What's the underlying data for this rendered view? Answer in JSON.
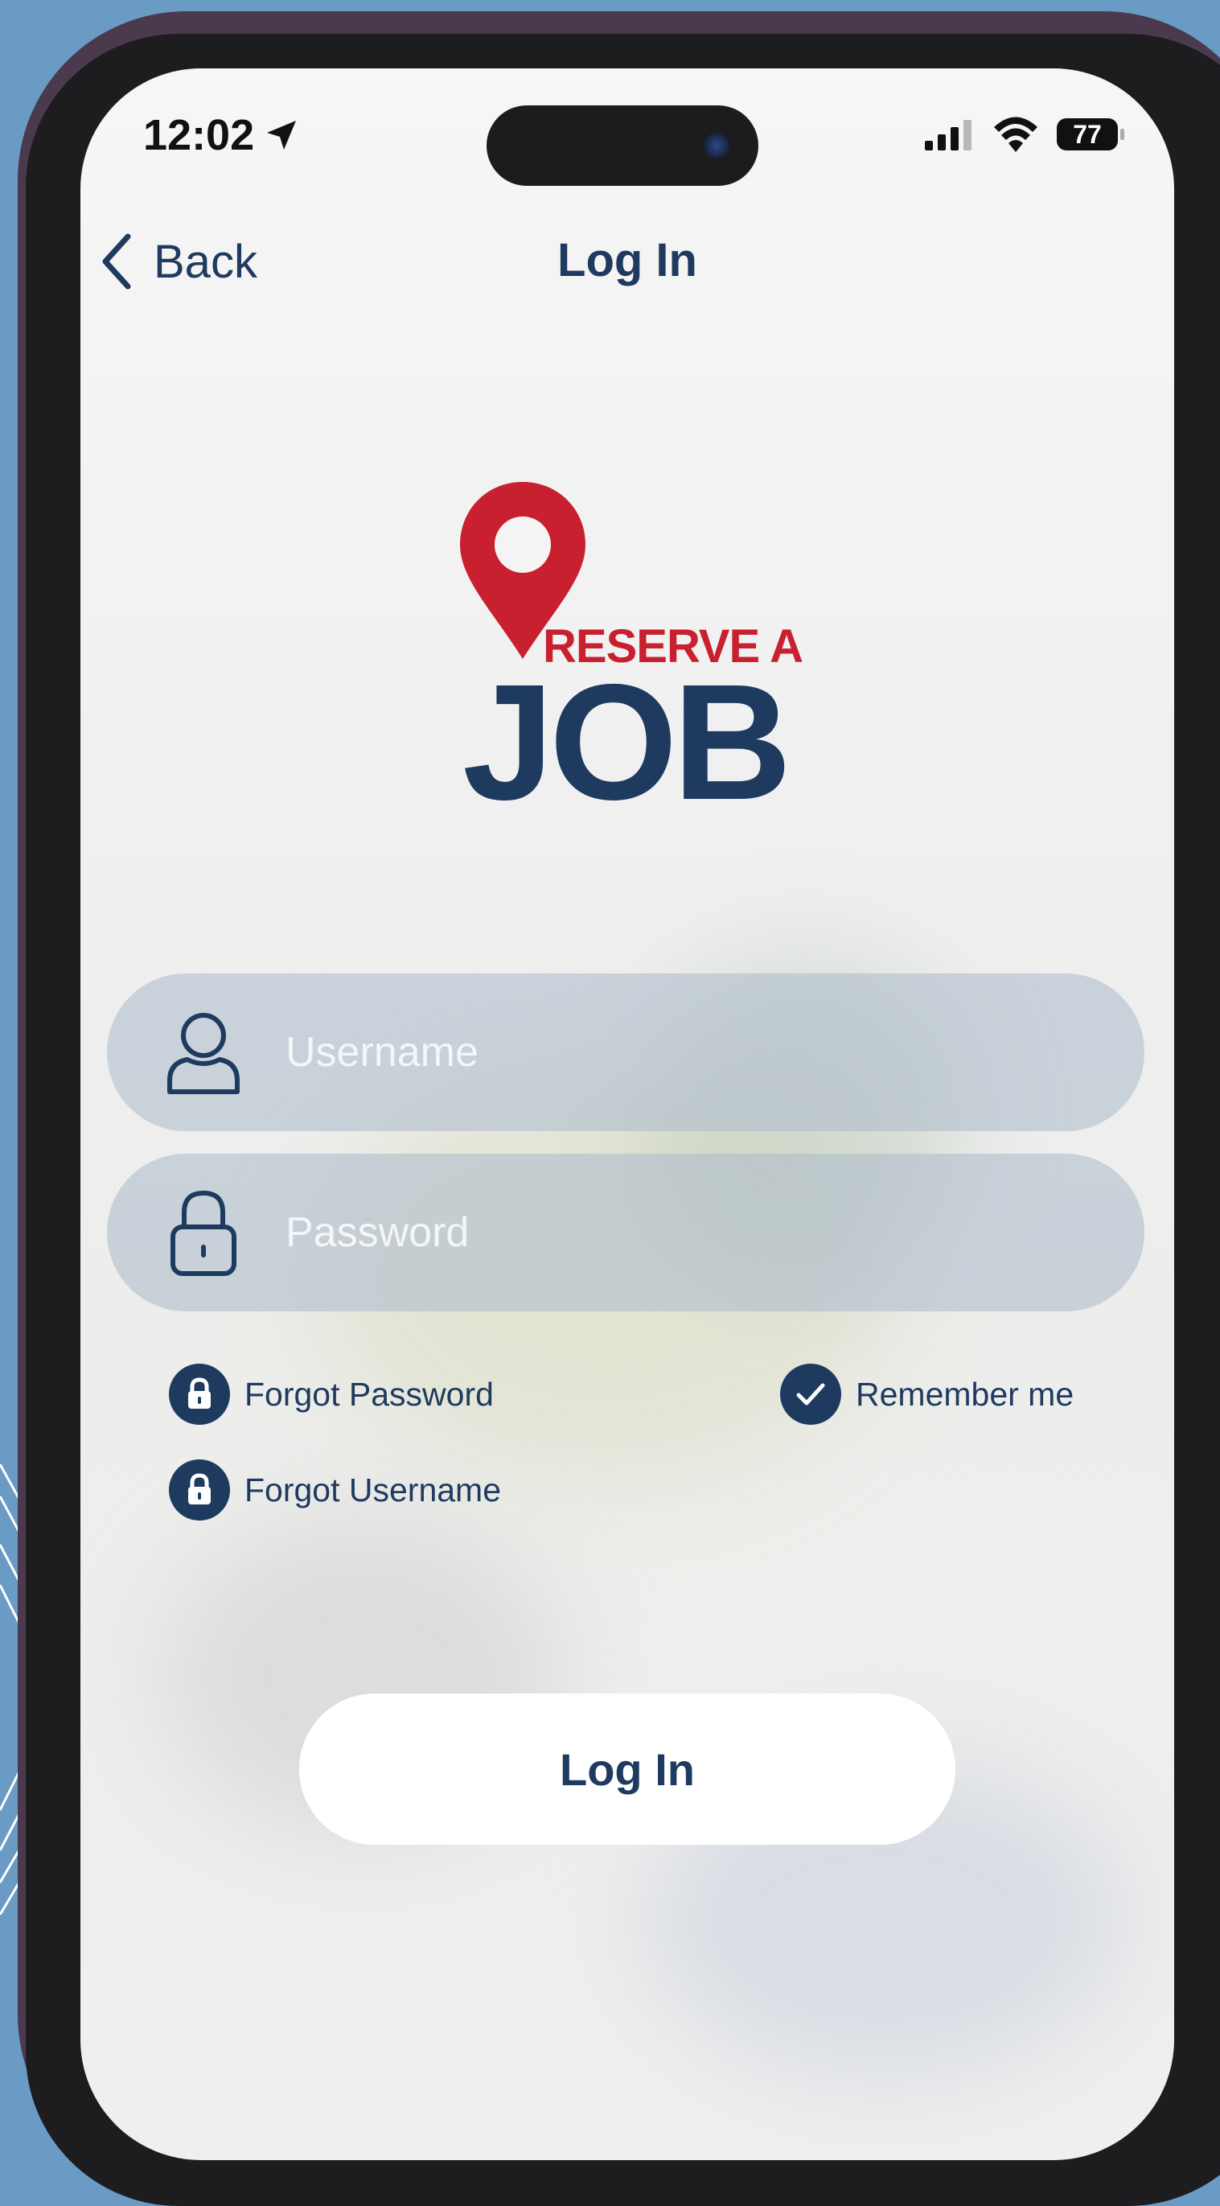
{
  "status_bar": {
    "time": "12:02",
    "battery": "77"
  },
  "nav": {
    "back_label": "Back",
    "title": "Log In"
  },
  "logo": {
    "small_text": "RESERVE A",
    "big_text": "JOB"
  },
  "form": {
    "username_placeholder": "Username",
    "password_placeholder": "Password"
  },
  "links": {
    "forgot_password": "Forgot Password",
    "forgot_username": "Forgot Username",
    "remember_me": "Remember me"
  },
  "remember_me_checked": true,
  "login_button": "Log In",
  "colors": {
    "navy": "#1f3a5f",
    "brand_red": "#c8202f",
    "field_fill": "#b2becd",
    "background": "#6a9bc4"
  }
}
